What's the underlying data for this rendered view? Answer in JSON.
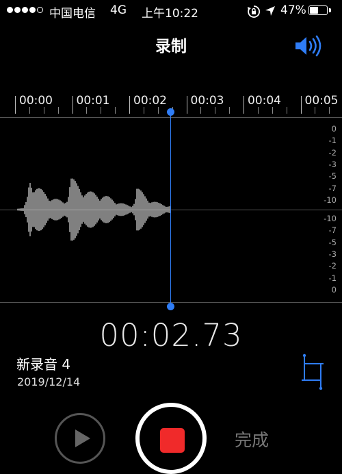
{
  "status_bar": {
    "carrier": "中国电信",
    "network": "4G",
    "time": "上午10:22",
    "battery": "47%",
    "battery_level": 0.47
  },
  "nav": {
    "title": "录制"
  },
  "timeline": {
    "labels": [
      "00:00",
      "00:01",
      "00:02",
      "00:03",
      "00:04",
      "00:05"
    ]
  },
  "level_scale": {
    "top": [
      "0",
      "-1",
      "-2",
      "-3",
      "-5",
      "-7",
      "-10"
    ],
    "bottom": [
      "-10",
      "-7",
      "-5",
      "-3",
      "-2",
      "-1",
      "0"
    ]
  },
  "timer": "00:02.73",
  "recording": {
    "name": "新录音 4",
    "date": "2019/12/14"
  },
  "controls": {
    "done_label": "完成"
  },
  "colors": {
    "accent": "#2f7df6",
    "record": "#f02a2a"
  }
}
